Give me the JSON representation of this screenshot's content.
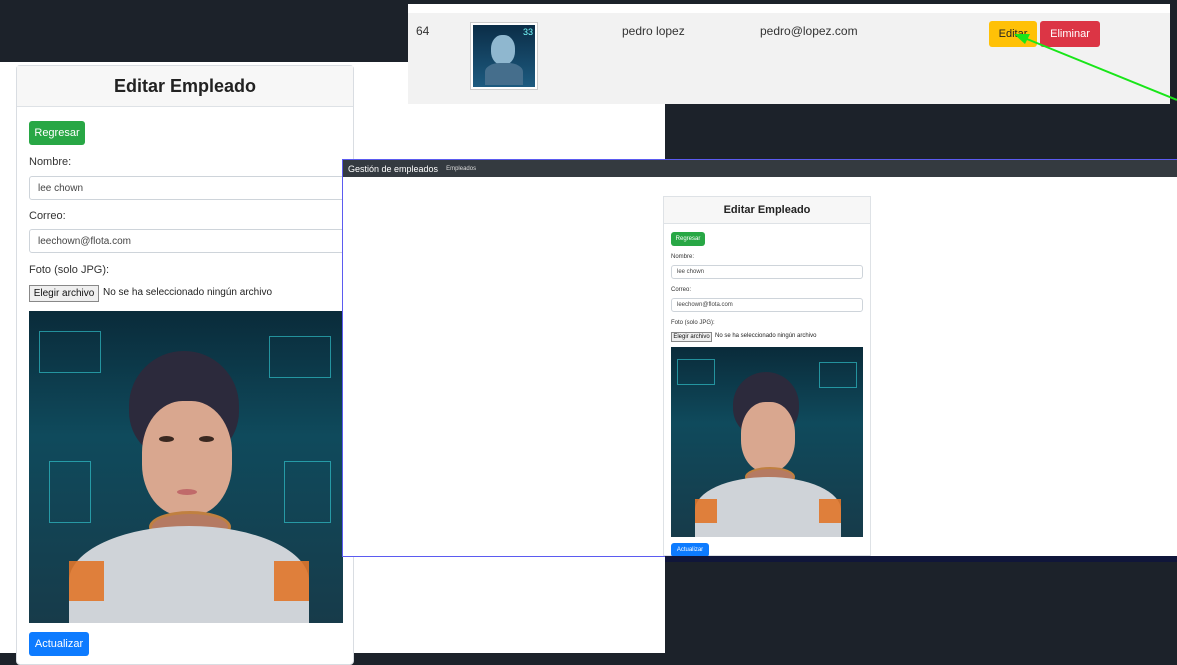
{
  "top_row": {
    "id": "64",
    "name": "pedro lopez",
    "email": "pedro@lopez.com",
    "edit_label": "Editar",
    "delete_label": "Eliminar",
    "avatar_number": "33"
  },
  "left_form": {
    "title": "Editar Empleado",
    "back_label": "Regresar",
    "name_label": "Nombre:",
    "name_value": "lee chown",
    "email_label": "Correo:",
    "email_value": "leechown@flota.com",
    "photo_label": "Foto (solo JPG):",
    "file_button": "Elegir archivo",
    "file_status": "No se ha seleccionado ningún archivo",
    "submit_label": "Actualizar"
  },
  "mid": {
    "brand": "Gestión de empleados",
    "nav_link": "Empleados",
    "title": "Editar Empleado",
    "back_label": "Regresar",
    "name_label": "Nombre:",
    "name_value": "lee chown",
    "email_label": "Correo:",
    "email_value": "leechown@flota.com",
    "photo_label": "Foto (solo JPG):",
    "file_button": "Elegir archivo",
    "file_status": "No se ha seleccionado ningún archivo",
    "submit_label": "Actualizar"
  },
  "colors": {
    "success": "#28a745",
    "primary": "#0d7bff",
    "warning": "#ffc107",
    "danger": "#dc3545",
    "annotation_arrow": "#19e619"
  }
}
